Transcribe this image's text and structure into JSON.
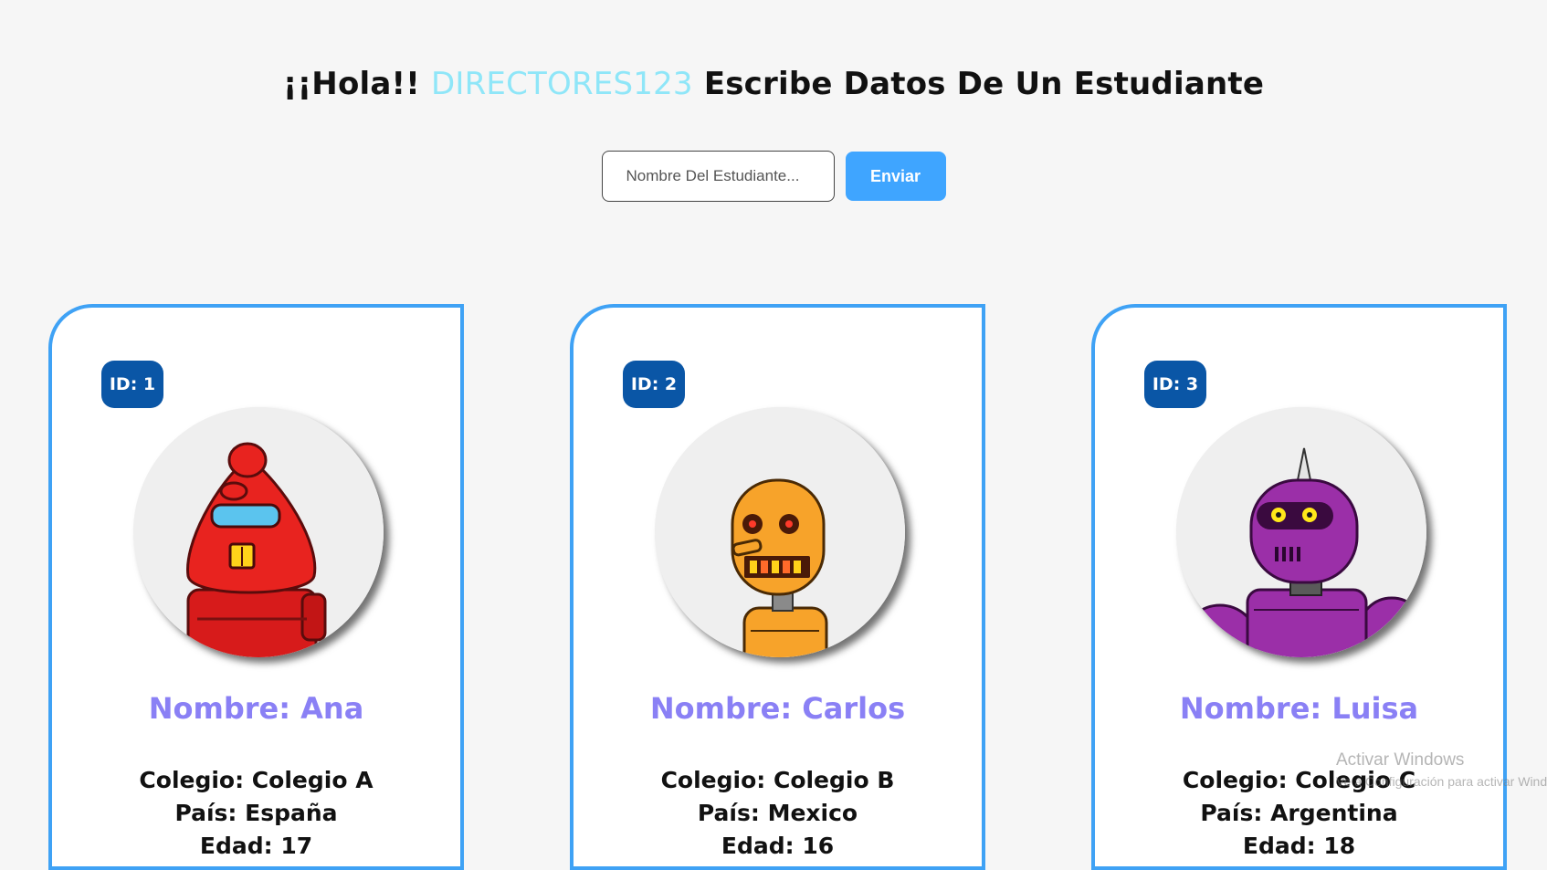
{
  "header": {
    "greeting": "¡¡Hola!!",
    "username": "DIRECTORES123",
    "instruction": "Escribe Datos De Un Estudiante"
  },
  "form": {
    "placeholder": "Nombre Del Estudiante...",
    "submit_label": "Enviar"
  },
  "students": [
    {
      "id_label": "ID: 1",
      "name": "Nombre: Ana",
      "school": "Colegio: Colegio A",
      "country": "País: España",
      "age": "Edad: 17",
      "avatar": "red-robot-icon",
      "color": "#e8231f"
    },
    {
      "id_label": "ID: 2",
      "name": "Nombre: Carlos",
      "school": "Colegio: Colegio B",
      "country": "País: Mexico",
      "age": "Edad: 16",
      "avatar": "orange-robot-icon",
      "color": "#f7a32a"
    },
    {
      "id_label": "ID: 3",
      "name": "Nombre: Luisa",
      "school": "Colegio: Colegio C",
      "country": "País: Argentina",
      "age": "Edad: 18",
      "avatar": "purple-robot-icon",
      "color": "#9b2fa8"
    }
  ],
  "colors": {
    "background": "#f6f6f6",
    "accent_blue": "#3fa5ff",
    "badge": "#0a56a6",
    "name_text": "#8a80f5",
    "username_text": "#8fe6f8"
  },
  "watermark": {
    "line1": "Activar Windows",
    "line2": "Ve a Configuración para activar Windows."
  }
}
